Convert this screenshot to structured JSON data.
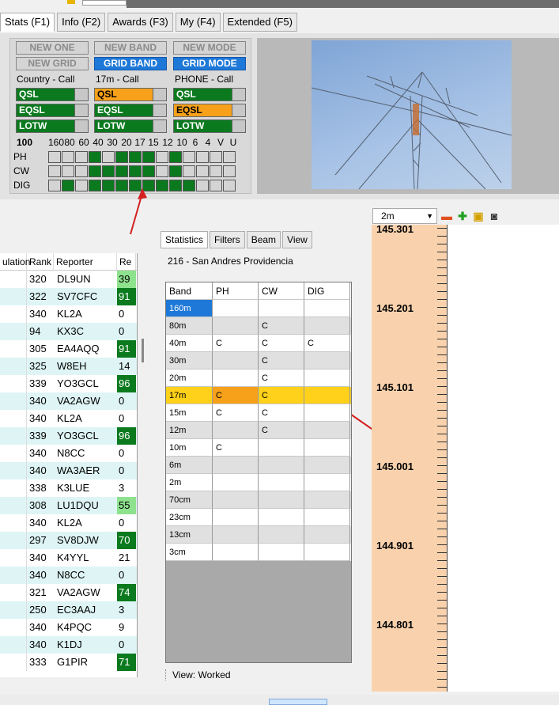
{
  "tabs": [
    "Stats (F1)",
    "Info (F2)",
    "Awards (F3)",
    "My (F4)",
    "Extended (F5)"
  ],
  "top_buttons": [
    {
      "label": "NEW ONE",
      "state": "off"
    },
    {
      "label": "NEW BAND",
      "state": "off"
    },
    {
      "label": "NEW MODE",
      "state": "off"
    },
    {
      "label": "NEW GRID",
      "state": "off"
    },
    {
      "label": "GRID BAND",
      "state": "on"
    },
    {
      "label": "GRID MODE",
      "state": "on"
    }
  ],
  "groups": [
    {
      "label": "Country - Call",
      "bars": [
        {
          "label": "QSL",
          "color": "green"
        },
        {
          "label": "EQSL",
          "color": "green"
        },
        {
          "label": "LOTW",
          "color": "green"
        }
      ]
    },
    {
      "label": "17m - Call",
      "bars": [
        {
          "label": "QSL",
          "color": "orange"
        },
        {
          "label": "EQSL",
          "color": "green"
        },
        {
          "label": "LOTW",
          "color": "green"
        }
      ]
    },
    {
      "label": "PHONE - Call",
      "bars": [
        {
          "label": "QSL",
          "color": "green"
        },
        {
          "label": "EQSL",
          "color": "orange"
        },
        {
          "label": "LOTW",
          "color": "green"
        }
      ]
    }
  ],
  "band_header": [
    "100",
    "160",
    "80",
    "60",
    "40",
    "30",
    "20",
    "17",
    "15",
    "12",
    "10",
    "6",
    "4",
    "V",
    "U"
  ],
  "band_grid": [
    {
      "label": "PH",
      "cells": [
        0,
        0,
        0,
        1,
        0,
        1,
        1,
        1,
        0,
        1,
        0,
        0,
        0,
        0
      ]
    },
    {
      "label": "CW",
      "cells": [
        0,
        0,
        0,
        1,
        1,
        1,
        1,
        1,
        0,
        1,
        0,
        0,
        0,
        0
      ]
    },
    {
      "label": "DIG",
      "cells": [
        0,
        1,
        0,
        1,
        1,
        1,
        1,
        1,
        1,
        1,
        1,
        0,
        0,
        0
      ]
    }
  ],
  "left_table": {
    "headers": [
      "ulation",
      "Rank",
      "Reporter",
      "Re"
    ],
    "rows": [
      {
        "rank": "320",
        "reporter": "DL9UN",
        "re": "39",
        "style": "lg"
      },
      {
        "rank": "322",
        "reporter": "SV7CFC",
        "re": "91",
        "style": "dg"
      },
      {
        "rank": "340",
        "reporter": "KL2A",
        "re": "0",
        "style": ""
      },
      {
        "rank": "94",
        "reporter": "KX3C",
        "re": "0",
        "style": ""
      },
      {
        "rank": "305",
        "reporter": "EA4AQQ",
        "re": "91",
        "style": "dg"
      },
      {
        "rank": "325",
        "reporter": "W8EH",
        "re": "14",
        "style": ""
      },
      {
        "rank": "339",
        "reporter": "YO3GCL",
        "re": "96",
        "style": "dg"
      },
      {
        "rank": "340",
        "reporter": "VA2AGW",
        "re": "0",
        "style": ""
      },
      {
        "rank": "340",
        "reporter": "KL2A",
        "re": "0",
        "style": ""
      },
      {
        "rank": "339",
        "reporter": "YO3GCL",
        "re": "96",
        "style": "dg"
      },
      {
        "rank": "340",
        "reporter": "N8CC",
        "re": "0",
        "style": ""
      },
      {
        "rank": "340",
        "reporter": "WA3AER",
        "re": "0",
        "style": ""
      },
      {
        "rank": "338",
        "reporter": "K3LUE",
        "re": "3",
        "style": ""
      },
      {
        "rank": "308",
        "reporter": "LU1DQU",
        "re": "55",
        "style": "lg"
      },
      {
        "rank": "340",
        "reporter": "KL2A",
        "re": "0",
        "style": ""
      },
      {
        "rank": "297",
        "reporter": "SV8DJW",
        "re": "70",
        "style": "dg"
      },
      {
        "rank": "340",
        "reporter": "K4YYL",
        "re": "21",
        "style": ""
      },
      {
        "rank": "340",
        "reporter": "N8CC",
        "re": "0",
        "style": ""
      },
      {
        "rank": "321",
        "reporter": "VA2AGW",
        "re": "74",
        "style": "dg"
      },
      {
        "rank": "250",
        "reporter": "EC3AAJ",
        "re": "3",
        "style": ""
      },
      {
        "rank": "340",
        "reporter": "K4PQC",
        "re": "9",
        "style": ""
      },
      {
        "rank": "340",
        "reporter": "K1DJ",
        "re": "0",
        "style": ""
      },
      {
        "rank": "333",
        "reporter": "G1PIR",
        "re": "71",
        "style": "dg"
      }
    ]
  },
  "mid_tabs": [
    "Statistics",
    "Filters",
    "Beam",
    "View"
  ],
  "dxcc": "216 - San Andres  Providencia",
  "band_table": {
    "headers": [
      "Band",
      "PH",
      "CW",
      "DIG"
    ],
    "rows": [
      {
        "band": "160m",
        "ph": "",
        "cw": "",
        "dig": "",
        "hl": "sel"
      },
      {
        "band": "80m",
        "ph": "",
        "cw": "C",
        "dig": "",
        "hl": ""
      },
      {
        "band": "40m",
        "ph": "C",
        "cw": "C",
        "dig": "C",
        "hl": ""
      },
      {
        "band": "30m",
        "ph": "",
        "cw": "C",
        "dig": "",
        "hl": ""
      },
      {
        "band": "20m",
        "ph": "",
        "cw": "C",
        "dig": "",
        "hl": ""
      },
      {
        "band": "17m",
        "ph": "C",
        "cw": "C",
        "dig": "",
        "hl": "yellow"
      },
      {
        "band": "15m",
        "ph": "C",
        "cw": "C",
        "dig": "",
        "hl": ""
      },
      {
        "band": "12m",
        "ph": "",
        "cw": "C",
        "dig": "",
        "hl": ""
      },
      {
        "band": "10m",
        "ph": "C",
        "cw": "",
        "dig": "",
        "hl": ""
      },
      {
        "band": "6m",
        "ph": "",
        "cw": "",
        "dig": "",
        "hl": ""
      },
      {
        "band": "2m",
        "ph": "",
        "cw": "",
        "dig": "",
        "hl": ""
      },
      {
        "band": "70cm",
        "ph": "",
        "cw": "",
        "dig": "",
        "hl": ""
      },
      {
        "band": "23cm",
        "ph": "",
        "cw": "",
        "dig": "",
        "hl": ""
      },
      {
        "band": "13cm",
        "ph": "",
        "cw": "",
        "dig": "",
        "hl": ""
      },
      {
        "band": "3cm",
        "ph": "",
        "cw": "",
        "dig": "",
        "hl": ""
      }
    ]
  },
  "view_label": "View:  Worked",
  "ruler": {
    "band_select": "2m",
    "freqs": [
      "145.301",
      "145.201",
      "145.101",
      "145.001",
      "144.901",
      "144.801"
    ]
  },
  "colors": {
    "green": "#0b7a1e",
    "orange": "#f7a11a",
    "blue": "#1e78d8",
    "ruler": "#f9d2ad",
    "arrow": "#d42020"
  }
}
